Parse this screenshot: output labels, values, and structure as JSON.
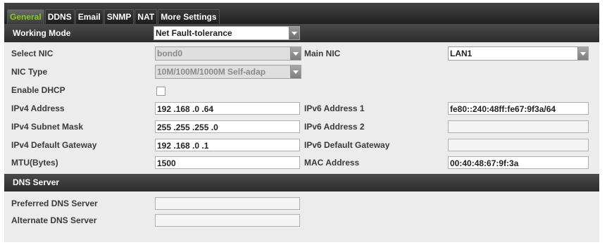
{
  "tabs": [
    {
      "label": "General"
    },
    {
      "label": "DDNS"
    },
    {
      "label": "Email"
    },
    {
      "label": "SNMP"
    },
    {
      "label": "NAT"
    },
    {
      "label": "More Settings"
    }
  ],
  "working_mode": {
    "label": "Working Mode",
    "value": "Net Fault-tolerance"
  },
  "select_nic": {
    "label": "Select NIC",
    "value": "bond0"
  },
  "main_nic": {
    "label": "Main NIC",
    "value": "LAN1"
  },
  "nic_type": {
    "label": "NIC Type",
    "value": "10M/100M/1000M Self-adap"
  },
  "enable_dhcp": {
    "label": "Enable DHCP",
    "checked": false
  },
  "ipv4_address": {
    "label": "IPv4 Address",
    "value": "192 .168 .0     .64"
  },
  "ipv4_subnet": {
    "label": "IPv4 Subnet Mask",
    "value": "255 .255 .255 .0"
  },
  "ipv4_gateway": {
    "label": "IPv4 Default Gateway",
    "value": "192 .168 .0     .1"
  },
  "mtu": {
    "label": "MTU(Bytes)",
    "value": "1500"
  },
  "ipv6_address1": {
    "label": "IPv6 Address 1",
    "value": "fe80::240:48ff:fe67:9f3a/64"
  },
  "ipv6_address2": {
    "label": "IPv6 Address 2",
    "value": ""
  },
  "ipv6_gateway": {
    "label": "IPv6 Default Gateway",
    "value": ""
  },
  "mac_address": {
    "label": "MAC Address",
    "value": "00:40:48:67:9f:3a"
  },
  "dns": {
    "title": "DNS Server",
    "preferred": {
      "label": "Preferred DNS Server",
      "value": ""
    },
    "alternate": {
      "label": "Alternate DNS Server",
      "value": ""
    }
  },
  "colors": {
    "active_tab": "#88cc22",
    "bar_dark": "#2c2c2c",
    "panel": "#ececec"
  }
}
